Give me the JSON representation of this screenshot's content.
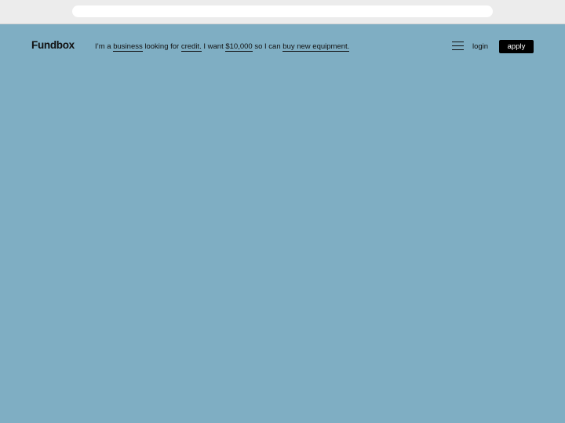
{
  "browser": {
    "address_value": ""
  },
  "header": {
    "logo": "Fundbox",
    "sentence": {
      "part1": "I’m a ",
      "entity": "business",
      "part2": " looking for ",
      "product": "credit.",
      "part3": " I want ",
      "amount": "$10,000",
      "part4": " so I can ",
      "purpose": "buy new equipment."
    },
    "menu_icon": "hamburger-menu-icon",
    "login_label": "login",
    "apply_label": "apply"
  },
  "colors": {
    "page_background": "#7faec3",
    "browser_chrome": "#ececec",
    "text": "#111111",
    "button_background": "#000000",
    "button_text": "#ffffff"
  }
}
